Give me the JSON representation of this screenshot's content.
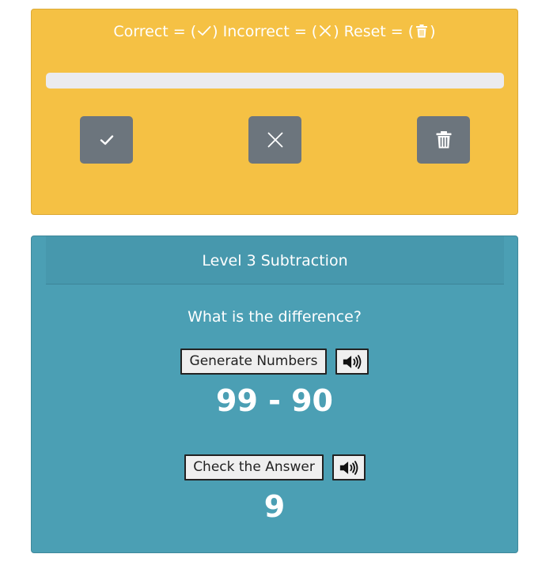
{
  "score_panel": {
    "legend": {
      "correct_label": "Correct = (",
      "incorrect_label": ") Incorrect = (",
      "reset_label": ") Reset = (",
      "end_label": ")"
    },
    "progress_fraction": 0,
    "buttons": {
      "correct_icon": "check-icon",
      "incorrect_icon": "x-icon",
      "reset_icon": "trash-icon"
    },
    "colors": {
      "panel": "#f5c144",
      "button": "#6c757d",
      "track": "#ebebee"
    }
  },
  "quiz": {
    "title": "Level 3 Subtraction",
    "question": "What is the difference?",
    "generate_label": "Generate Numbers",
    "problem": "99 - 90",
    "check_label": "Check the Answer",
    "answer": "9",
    "speaker_icon": "speaker-icon",
    "colors": {
      "panel": "#4b9fb4"
    }
  }
}
